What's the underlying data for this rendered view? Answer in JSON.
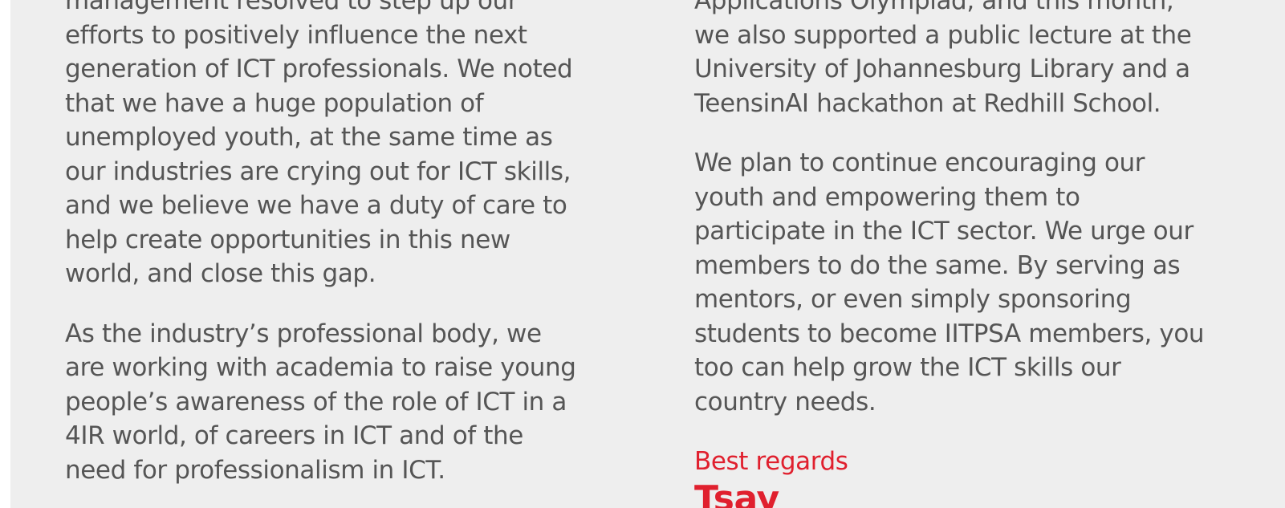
{
  "left_column": {
    "paragraphs": [
      {
        "lines": [
          "management resolved to step up our",
          "efforts to positively influence the next",
          "generation of ICT professionals. We noted",
          "that we have a huge population of",
          "unemployed youth, at the same time as",
          "our industries are crying out for ICT skills,",
          "and we believe we have a duty of care to",
          "help create opportunities in this new",
          "world, and close this gap."
        ]
      },
      {
        "lines": [
          "As the industry’s professional body, we",
          "are working with academia to raise young",
          "people’s awareness of the role of ICT in a",
          "4IR world, of careers in ICT and of the",
          "need for professionalism in ICT."
        ]
      }
    ]
  },
  "right_column": {
    "paragraphs": [
      {
        "lines": [
          "Applications Olympiad, and this month,",
          "we also supported a public lecture at the",
          "University of Johannesburg Library and a",
          "TeensinAI hackathon at Redhill School."
        ]
      },
      {
        "lines": [
          "We plan to continue encouraging our",
          "youth and empowering them to",
          "participate in the ICT sector. We urge our",
          "members to do the same. By serving as",
          "mentors, or even simply sponsoring",
          "students to become IITPSA members, you",
          "too can help grow the ICT skills our",
          "country needs."
        ]
      }
    ],
    "closing": "Best regards",
    "signature": "Tsay"
  },
  "colors": {
    "background": "#eeeeee",
    "text": "#555555",
    "accent": "#e0202e"
  }
}
